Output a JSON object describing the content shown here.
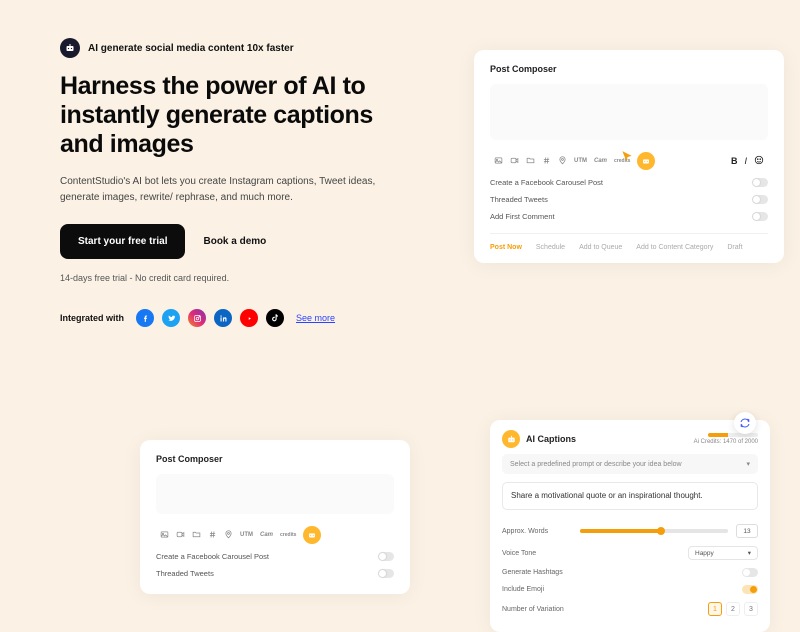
{
  "hero": {
    "tagline": "AI generate social media content 10x faster",
    "headline": "Harness the power of AI to instantly generate captions and images",
    "subtext": "ContentStudio's AI bot lets you create Instagram captions, Tweet ideas, generate images, rewrite/ rephrase, and much more.",
    "cta_primary": "Start your free trial",
    "cta_secondary": "Book a demo",
    "trial_note": "14-days free trial - No credit card required.",
    "integrated_label": "Integrated with",
    "see_more": "See more"
  },
  "composer": {
    "title": "Post Composer",
    "options": {
      "carousel": "Create a Facebook Carousel Post",
      "threaded": "Threaded Tweets",
      "first_comment": "Add First Comment"
    },
    "tabs": {
      "post_now": "Post Now",
      "schedule": "Schedule",
      "add_queue": "Add to Queue",
      "add_cat": "Add to Content Category",
      "draft": "Draft"
    },
    "toolbar_labels": {
      "utm": "UTM",
      "cam": "Cam",
      "credits": "credits"
    }
  },
  "ai": {
    "title": "AI Captions",
    "credits_text": "Ai Credits: 1470 of 2000",
    "select_placeholder": "Select a predefined prompt or describe your idea below",
    "prompt_value": "Share a motivational quote or an inspirational thought.",
    "fields": {
      "approx_words": "Approx. Words",
      "approx_val": "13",
      "voice_tone": "Voice Tone",
      "voice_value": "Happy",
      "gen_hashtags": "Generate Hashtags",
      "include_emoji": "Include Emoji",
      "num_variation": "Number of Variation"
    },
    "variations": [
      "1",
      "2",
      "3"
    ]
  }
}
